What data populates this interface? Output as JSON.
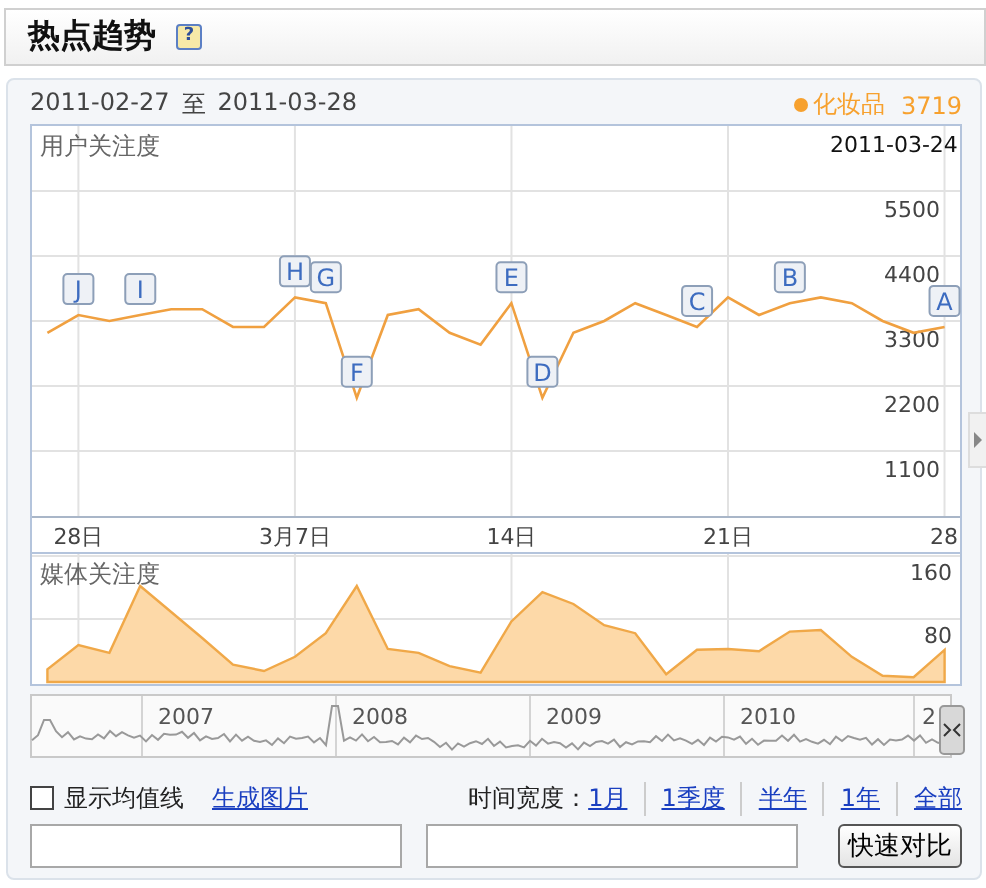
{
  "header": {
    "title": "热点趋势",
    "help": "?"
  },
  "range": {
    "start": "2011-02-27",
    "separator": "至",
    "end": "2011-03-28"
  },
  "legend": [
    {
      "name": "化妆品",
      "value": "3719",
      "color": "#f7a12e"
    }
  ],
  "user_attention": {
    "hover_date": "2011-03-24",
    "chart_data": {
      "type": "line",
      "title": "用户关注度",
      "grid": true,
      "categories": [
        null,
        "28日",
        null,
        null,
        null,
        null,
        null,
        null,
        "3月7日",
        null,
        null,
        null,
        null,
        null,
        null,
        "14日",
        null,
        null,
        null,
        null,
        null,
        null,
        "21日",
        null,
        null,
        null,
        null,
        null,
        null,
        "28"
      ],
      "series": [
        {
          "color": "#f0a040",
          "values": [
            3100,
            3400,
            3300,
            3400,
            3500,
            3500,
            3200,
            3200,
            3700,
            3600,
            2000,
            3400,
            3500,
            3100,
            2900,
            3600,
            2000,
            3100,
            3300,
            3600,
            3400,
            3200,
            3700,
            3400,
            3600,
            3700,
            3600,
            3300,
            3100,
            3200
          ]
        }
      ],
      "ylim": [
        0,
        6600
      ],
      "yticks": [
        1100,
        2200,
        3300,
        4400,
        5500
      ],
      "annotations": [
        {
          "text": "J"
        },
        {
          "text": "I"
        },
        {
          "text": "H"
        },
        {
          "text": "G"
        },
        {
          "text": "F"
        },
        {
          "text": "E"
        },
        {
          "text": "D"
        },
        {
          "text": "C"
        },
        {
          "text": "B"
        },
        {
          "text": "A"
        }
      ]
    }
  },
  "media_attention": {
    "chart_data": {
      "type": "area",
      "title": "媒体关注度",
      "grid": true,
      "categories": [
        null,
        null,
        null,
        null,
        null,
        null,
        null,
        null,
        null,
        null,
        null,
        null,
        null,
        null,
        null,
        null,
        null,
        null,
        null,
        null,
        null,
        null,
        null,
        null,
        null,
        null,
        null,
        null,
        null,
        null
      ],
      "series": [
        {
          "color": "#f0a848",
          "values": [
            16,
            47,
            37,
            122,
            89,
            56,
            22,
            14,
            32,
            62,
            122,
            42,
            37,
            20,
            12,
            77,
            114,
            99,
            72,
            62,
            10,
            41,
            42,
            39,
            64,
            66,
            32,
            8,
            6,
            41
          ]
        }
      ],
      "ylim": [
        0,
        160
      ],
      "yticks": [
        80,
        160
      ]
    }
  },
  "navigator": {
    "years": [
      "2007",
      "2008",
      "2009",
      "2010",
      "2"
    ]
  },
  "controls": {
    "average_line": {
      "label": "显示均值线",
      "checked": false
    },
    "export_link": "生成图片",
    "span_label": "时间宽度：",
    "spans": [
      "1月",
      "1季度",
      "半年",
      "1年",
      "全部"
    ]
  },
  "compare": {
    "fields": [
      {
        "kind": "text"
      },
      {
        "kind": "text"
      }
    ],
    "button": "快速对比"
  }
}
